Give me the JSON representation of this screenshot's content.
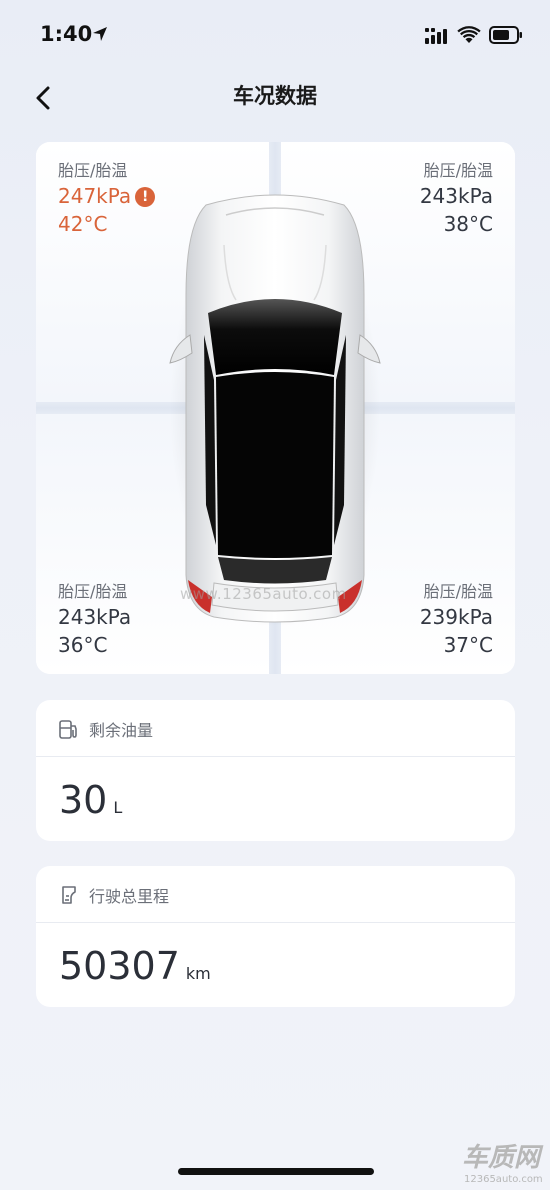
{
  "status_bar": {
    "time": "1:40"
  },
  "nav": {
    "title": "车况数据"
  },
  "tires": {
    "front_left": {
      "label": "胎压/胎温",
      "pressure": "247kPa",
      "temp": "42°C",
      "warning_symbol": "!"
    },
    "front_right": {
      "label": "胎压/胎温",
      "pressure": "243kPa",
      "temp": "38°C"
    },
    "rear_left": {
      "label": "胎压/胎温",
      "pressure": "243kPa",
      "temp": "36°C"
    },
    "rear_right": {
      "label": "胎压/胎温",
      "pressure": "239kPa",
      "temp": "37°C"
    }
  },
  "watermark": "www.12365auto.com",
  "fuel": {
    "title": "剩余油量",
    "value": "30",
    "unit": "L",
    "icon": "fuel-pump-icon"
  },
  "mileage": {
    "title": "行驶总里程",
    "value": "50307",
    "unit": "km",
    "icon": "odometer-icon"
  },
  "brand": {
    "logo_text": "车质网",
    "site": "12365auto.com"
  },
  "colors": {
    "warning": "#d9643a",
    "text_primary": "#2b2f38",
    "text_secondary": "#6b6f78"
  }
}
